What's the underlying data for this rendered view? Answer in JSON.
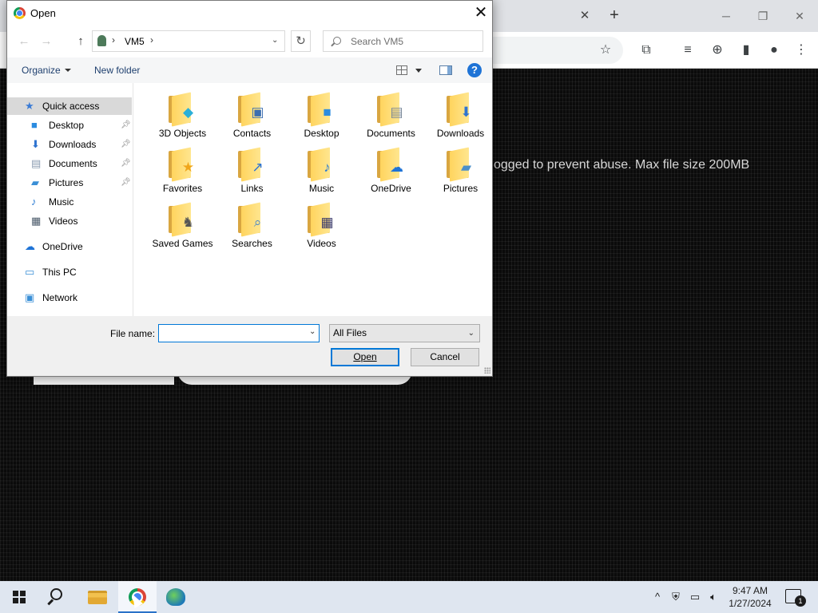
{
  "browser": {
    "page_notice": "ogged to prevent abuse. Max file size 200MB",
    "tab_close_symbol": "✕",
    "new_tab_symbol": "+",
    "window_controls": [
      "─",
      "❐",
      "✕"
    ],
    "toolbar_icons": [
      "star-icon",
      "extensions-icon",
      "media-icon",
      "download-icon",
      "side-panel-icon",
      "profile-icon",
      "menu-icon"
    ]
  },
  "dialog": {
    "title": "Open",
    "close_symbol": "✕",
    "address": {
      "back": "←",
      "forward": "→",
      "up": "↑",
      "separator": "›",
      "path": "VM5",
      "refresh": "↻"
    },
    "search": {
      "placeholder": "Search VM5"
    },
    "commands": {
      "organize": "Organize",
      "new_folder": "New folder",
      "help": "?"
    },
    "nav": [
      {
        "label": "Quick access",
        "icon": "star-icon",
        "color": "#3a7bd5",
        "pinned": false,
        "selected": true
      },
      {
        "label": "Desktop",
        "icon": "desktop-icon",
        "color": "#2b8ce0",
        "pinned": true
      },
      {
        "label": "Downloads",
        "icon": "download-arrow-icon",
        "color": "#2f74d0",
        "pinned": true
      },
      {
        "label": "Documents",
        "icon": "document-icon",
        "color": "#8a9bb0",
        "pinned": true
      },
      {
        "label": "Pictures",
        "icon": "pictures-icon",
        "color": "#3a8fd6",
        "pinned": true
      },
      {
        "label": "Music",
        "icon": "music-note-icon",
        "color": "#2a7ad2"
      },
      {
        "label": "Videos",
        "icon": "videos-icon",
        "color": "#4a5a6a"
      },
      {
        "label": "OneDrive",
        "icon": "cloud-icon",
        "color": "#1e73d6"
      },
      {
        "label": "This PC",
        "icon": "computer-icon",
        "color": "#3a8fd6"
      },
      {
        "label": "Network",
        "icon": "network-icon",
        "color": "#3a8fd6"
      }
    ],
    "folders": [
      {
        "label": "3D Objects",
        "icon": "cube-icon",
        "glyph": "◆",
        "color": "#2bb0d9"
      },
      {
        "label": "Contacts",
        "icon": "contact-card-icon",
        "glyph": "▣",
        "color": "#3d6fb0"
      },
      {
        "label": "Desktop",
        "icon": "desktop-icon",
        "glyph": "■",
        "color": "#2b8ce0"
      },
      {
        "label": "Documents",
        "icon": "document-icon",
        "glyph": "▤",
        "color": "#7a8899"
      },
      {
        "label": "Downloads",
        "icon": "download-arrow-icon",
        "glyph": "⬇",
        "color": "#2f74d0"
      },
      {
        "label": "Favorites",
        "icon": "star-icon",
        "glyph": "★",
        "color": "#f0a61c"
      },
      {
        "label": "Links",
        "icon": "link-arrow-icon",
        "glyph": "↗",
        "color": "#2f74d0"
      },
      {
        "label": "Music",
        "icon": "music-note-icon",
        "glyph": "♪",
        "color": "#2a7ad2"
      },
      {
        "label": "OneDrive",
        "icon": "cloud-icon",
        "glyph": "☁",
        "color": "#1e73d6"
      },
      {
        "label": "Pictures",
        "icon": "pictures-icon",
        "glyph": "▰",
        "color": "#4b8fc9"
      },
      {
        "label": "Saved Games",
        "icon": "chess-piece-icon",
        "glyph": "♞",
        "color": "#555555"
      },
      {
        "label": "Searches",
        "icon": "magnifier-icon",
        "glyph": "⌕",
        "color": "#4a88c8"
      },
      {
        "label": "Videos",
        "icon": "film-icon",
        "glyph": "▦",
        "color": "#3b3b6b"
      }
    ],
    "footer": {
      "file_name_label": "File name:",
      "file_name_value": "",
      "file_type": "All Files",
      "open_label": "Open",
      "cancel_label": "Cancel"
    }
  },
  "taskbar": {
    "items": [
      "start-icon",
      "search-icon",
      "file-explorer-icon",
      "chrome-icon",
      "network-app-icon"
    ],
    "tray_chevron": "^",
    "time": "9:47 AM",
    "date": "1/27/2024",
    "notification_count": "1"
  },
  "colors": {
    "accent": "#0078d7",
    "selected_nav": "#d9d9d9",
    "folder_yellow": "#ffd45e"
  }
}
